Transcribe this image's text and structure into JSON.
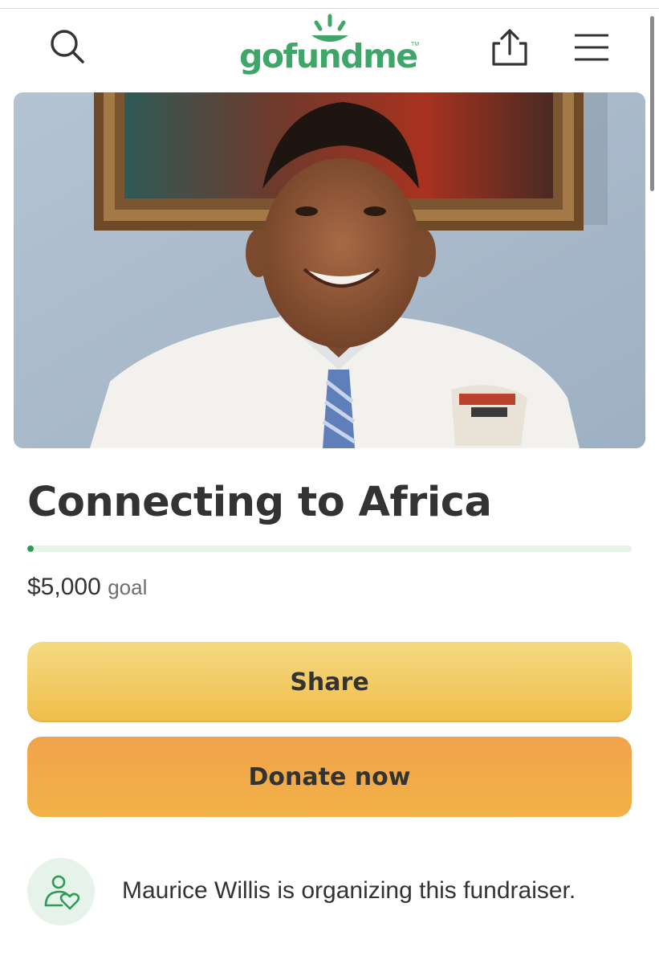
{
  "header": {
    "logo_text": "gofundme",
    "logo_tm": "TM"
  },
  "campaign": {
    "title": "Connecting to Africa",
    "goal_amount": "$5,000",
    "goal_label": "goal",
    "progress_fraction": 0.01
  },
  "buttons": {
    "share_label": "Share",
    "donate_label": "Donate now"
  },
  "organizer": {
    "text": "Maurice Willis is organizing this fundraiser."
  },
  "icons": [
    "search-icon",
    "share-upload-icon",
    "hamburger-menu-icon",
    "organizer-heart-icon"
  ],
  "colors": {
    "brand_green": "#3fa66a",
    "share_button": "#f2cf6a",
    "donate_button": "#f1a94a",
    "progress_fill": "#2d9b55",
    "progress_track": "#e5f3ea"
  }
}
